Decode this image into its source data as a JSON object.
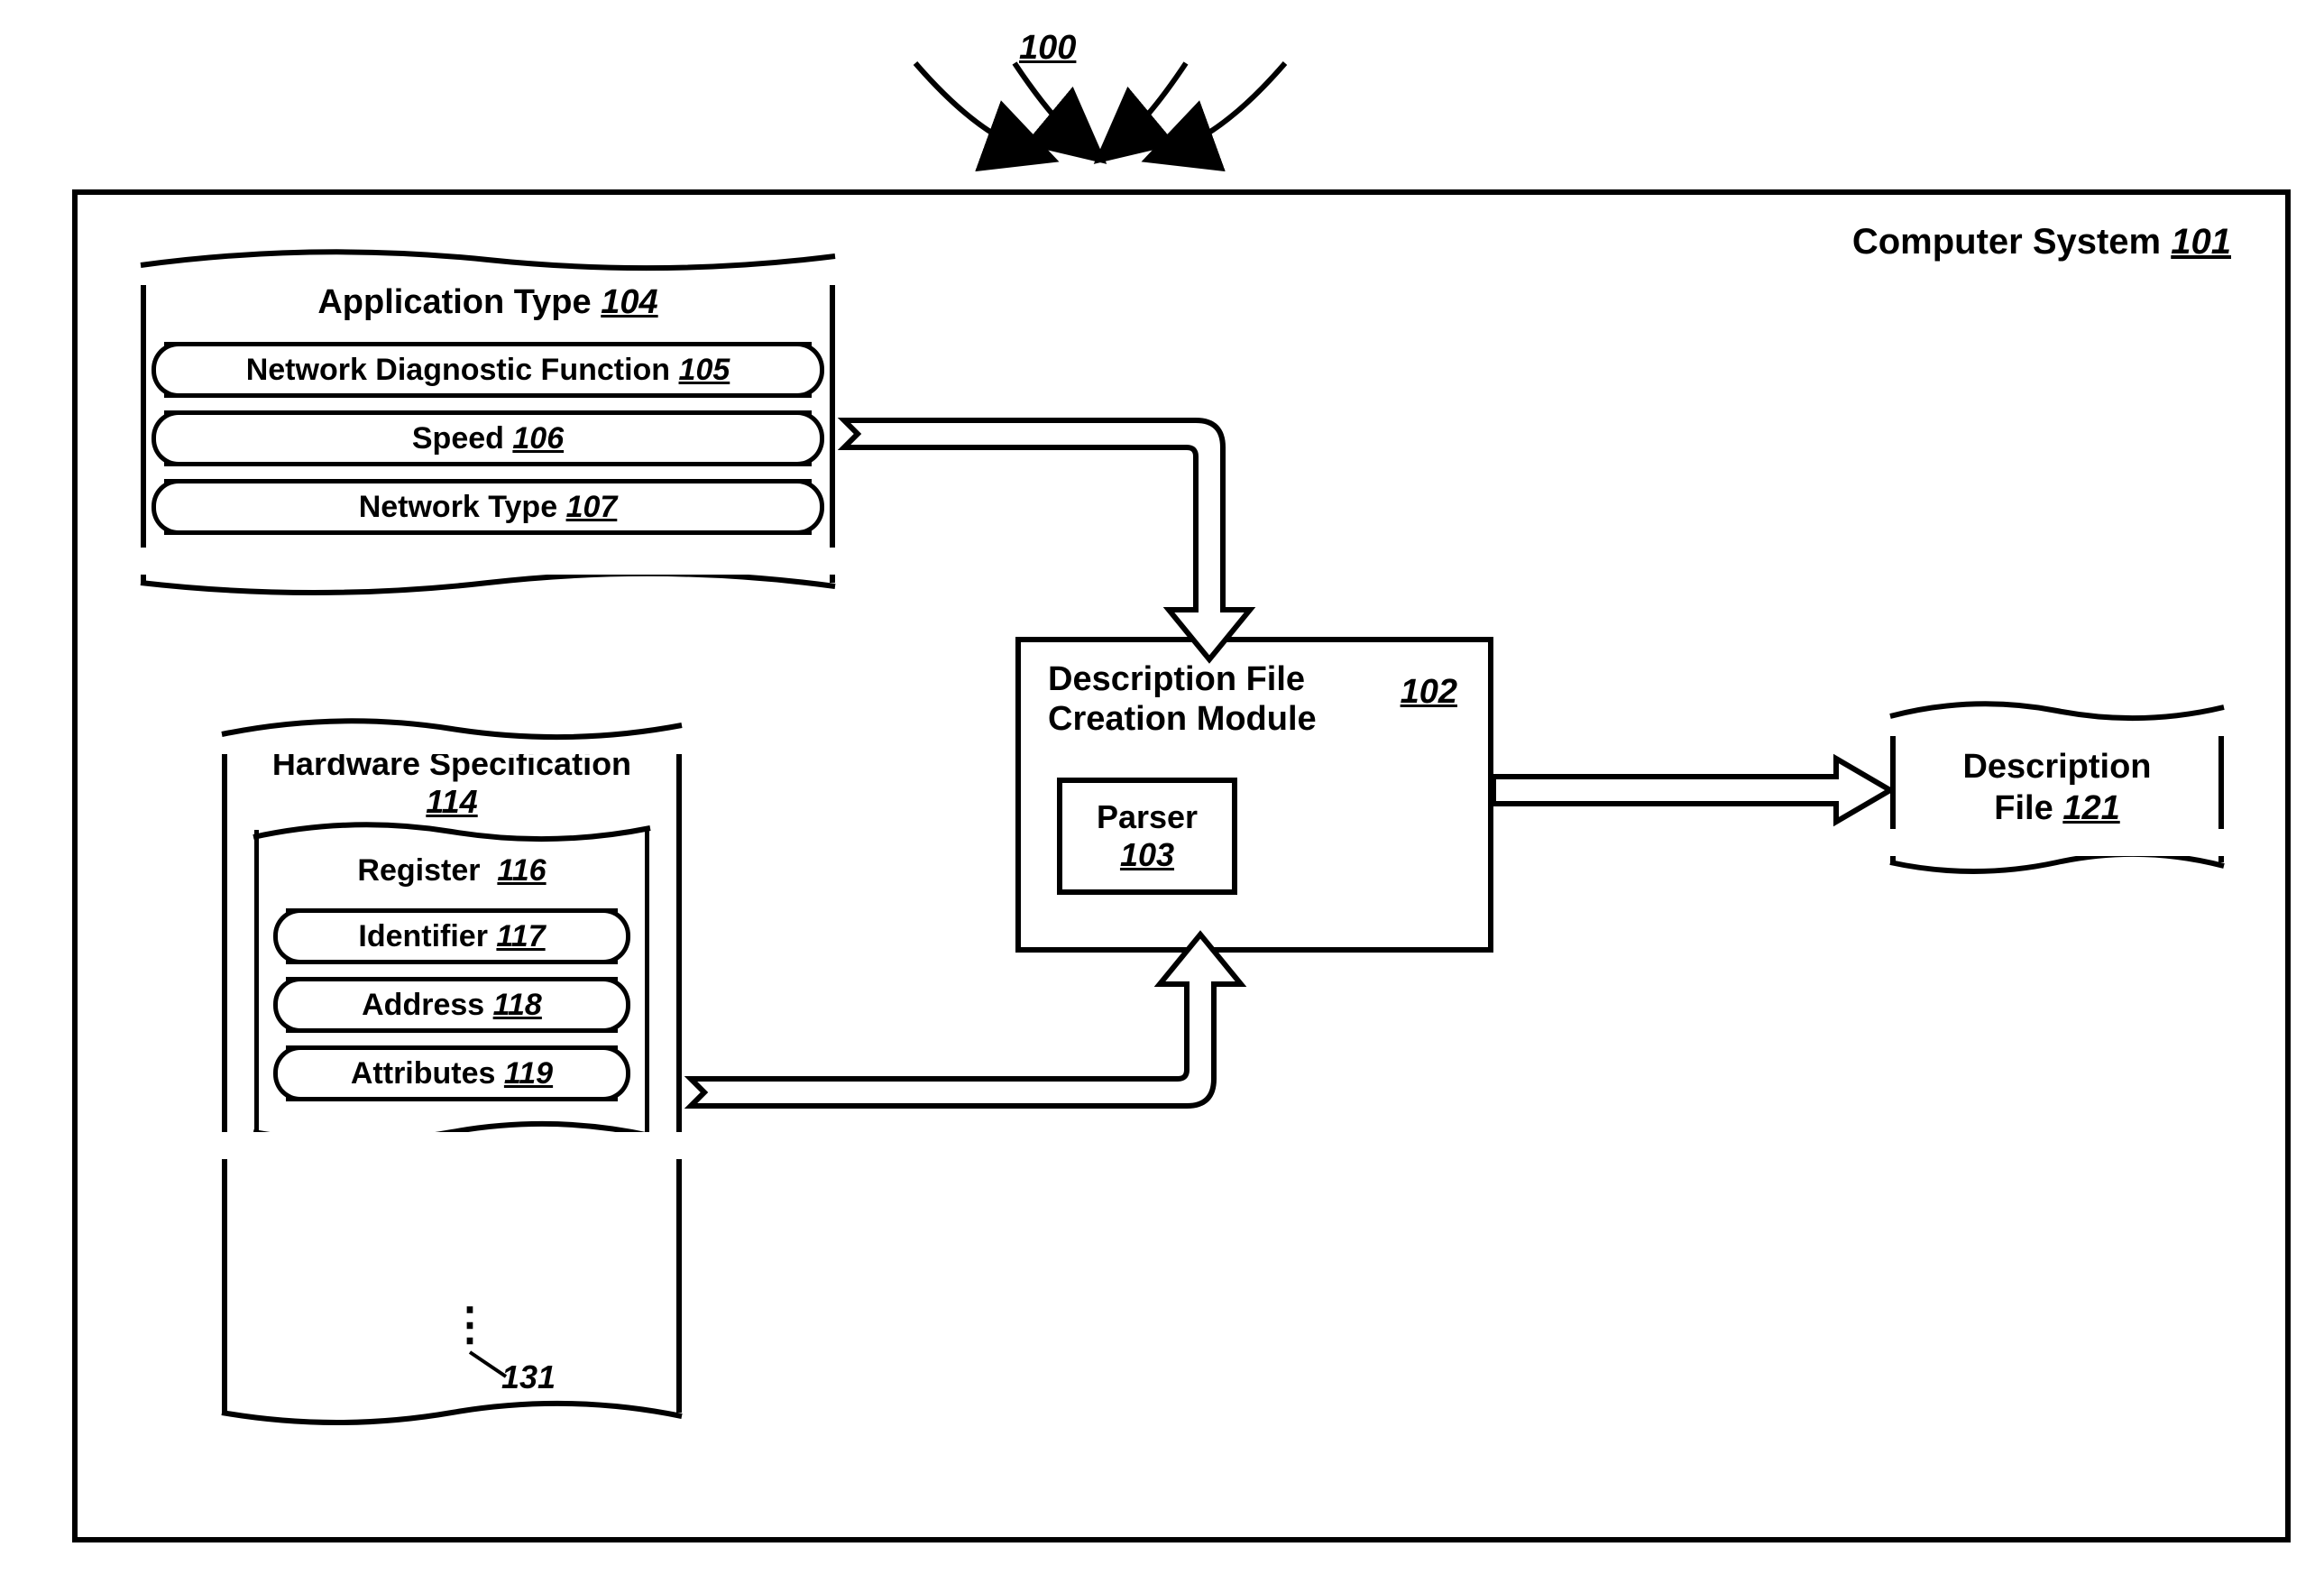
{
  "figure": {
    "top_ref": "100",
    "system_label": "Computer System",
    "system_ref": "101"
  },
  "app_type": {
    "title": "Application Type",
    "ref": "104",
    "items": [
      {
        "label": "Network Diagnostic Function",
        "ref": "105"
      },
      {
        "label": "Speed",
        "ref": "106"
      },
      {
        "label": "Network Type",
        "ref": "107"
      }
    ]
  },
  "hw_spec": {
    "title": "Hardware Specification",
    "ref": "114",
    "register": {
      "title": "Register",
      "ref": "116",
      "items": [
        {
          "label": "Identifier",
          "ref": "117"
        },
        {
          "label": "Address",
          "ref": "118"
        },
        {
          "label": "Attributes",
          "ref": "119"
        }
      ]
    },
    "ellipsis_ref": "131"
  },
  "module": {
    "title_line1": "Description File",
    "title_line2": "Creation Module",
    "ref": "102",
    "parser": {
      "label": "Parser",
      "ref": "103"
    }
  },
  "output": {
    "title_line1": "Description",
    "title_line2": "File",
    "ref": "121"
  }
}
